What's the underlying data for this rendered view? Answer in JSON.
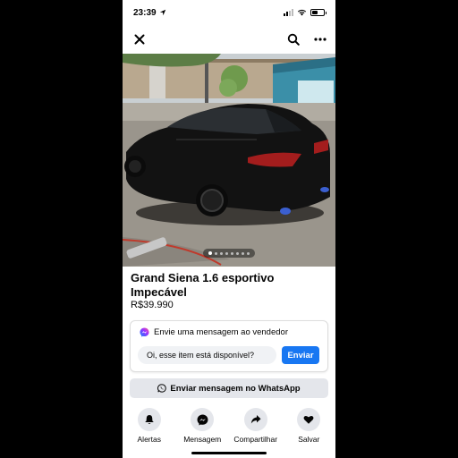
{
  "status_bar": {
    "time": "23:39"
  },
  "listing": {
    "title": "Grand Siena 1.6 esportivo Impecável",
    "price": "R$39.990",
    "photo_count": 8,
    "active_photo_index": 0
  },
  "message_card": {
    "header": "Envie uma mensagem ao vendedor",
    "input_value": "Oi, esse item está disponível?",
    "send_label": "Enviar"
  },
  "whatsapp_button": {
    "label": "Enviar mensagem no WhatsApp"
  },
  "actions": [
    {
      "label": "Alertas",
      "icon": "bell-icon"
    },
    {
      "label": "Mensagem",
      "icon": "messenger-icon"
    },
    {
      "label": "Compartilhar",
      "icon": "share-icon"
    },
    {
      "label": "Salvar",
      "icon": "heart-icon"
    }
  ],
  "colors": {
    "accent": "#1877f2",
    "button_gray": "#e4e6eb"
  }
}
